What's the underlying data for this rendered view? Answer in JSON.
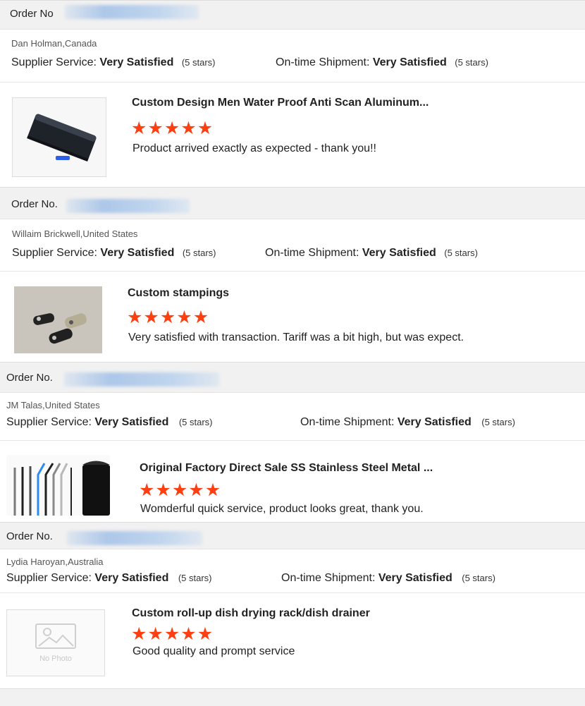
{
  "reviews": [
    {
      "order_label": "Order No",
      "buyer": "Dan Holman,Canada",
      "supplier_service_label": "Supplier Service:",
      "supplier_service_value": "Very Satisfied",
      "supplier_service_stars": "(5 stars)",
      "shipment_label": "On-time Shipment:",
      "shipment_value": "Very Satisfied",
      "shipment_stars": "(5 stars)",
      "product_title": "Custom Design Men Water Proof Anti Scan Aluminum...",
      "rating": 5,
      "feedback": "Product arrived exactly as expected - thank you!!",
      "thumbnail": "aluminum-wallet"
    },
    {
      "order_label": "Order No.",
      "buyer": "Willaim Brickwell,United States",
      "supplier_service_label": "Supplier Service:",
      "supplier_service_value": "Very Satisfied",
      "supplier_service_stars": "(5 stars)",
      "shipment_label": "On-time Shipment:",
      "shipment_value": "Very Satisfied",
      "shipment_stars": "(5 stars)",
      "product_title": "Custom stampings",
      "rating": 5,
      "feedback": "Very satisfied with transaction. Tariff was a bit high, but was expect.",
      "thumbnail": "metal-stampings"
    },
    {
      "order_label": "Order No.",
      "buyer": "JM Talas,United States",
      "supplier_service_label": "Supplier Service:",
      "supplier_service_value": "Very Satisfied",
      "supplier_service_stars": "(5 stars)",
      "shipment_label": "On-time Shipment:",
      "shipment_value": "Very Satisfied",
      "shipment_stars": "(5 stars)",
      "product_title": "Original Factory Direct Sale SS Stainless Steel Metal ...",
      "rating": 5,
      "feedback": "Womderful quick service, product looks great, thank you.",
      "thumbnail": "steel-straws"
    },
    {
      "order_label": "Order No.",
      "buyer": "Lydia Haroyan,Australia",
      "supplier_service_label": "Supplier Service:",
      "supplier_service_value": "Very Satisfied",
      "supplier_service_stars": "(5 stars)",
      "shipment_label": "On-time Shipment:",
      "shipment_value": "Very Satisfied",
      "shipment_stars": "(5 stars)",
      "product_title": "Custom roll-up dish drying rack/dish drainer",
      "rating": 5,
      "feedback": "Good quality and prompt service",
      "thumbnail": "no-photo",
      "thumbnail_text": "No Photo"
    }
  ],
  "colors": {
    "star": "#ff3f12",
    "order_bar": "#f1f1f1",
    "blurred_order_number": "#9fbfe8"
  }
}
